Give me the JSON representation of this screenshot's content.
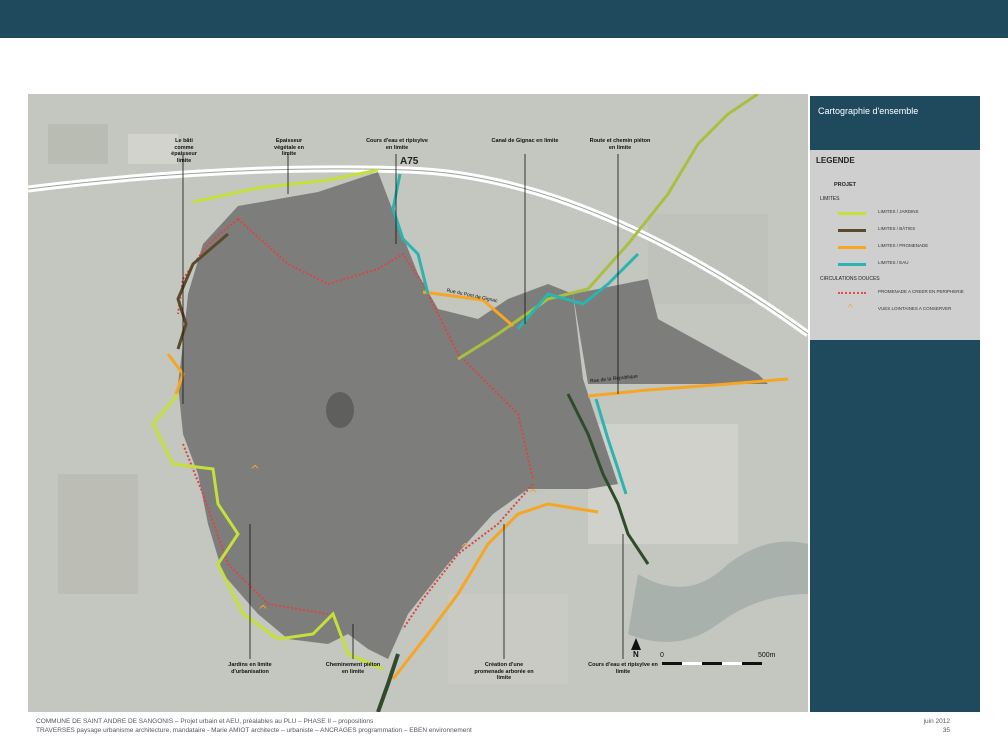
{
  "map": {
    "highway_label": "A75",
    "road_labels": {
      "pont_de_gignac": "Rue du Pont de Gignac",
      "republique": "Rue de la République"
    },
    "annotations_top": [
      {
        "id": "bati",
        "text": "Le bâti comme épaisseur limite"
      },
      {
        "id": "vegetale",
        "text": "Epaisseur végétale en limite"
      },
      {
        "id": "cours_eau",
        "text": "Cours d'eau et ripisylve en limite"
      },
      {
        "id": "canal",
        "text": "Canal de Gignac en limite"
      },
      {
        "id": "route",
        "text": "Route et chemin piéton en limite"
      }
    ],
    "annotations_bottom": [
      {
        "id": "jardins",
        "text": "Jardins en limite d'urbanisation"
      },
      {
        "id": "cheminement",
        "text": "Cheminement piéton en limite"
      },
      {
        "id": "promenade",
        "text": "Création d'une promenade arborée en limite"
      },
      {
        "id": "cours_eau_bas",
        "text": "Cours d'eau et ripisylve en limite"
      }
    ],
    "north_label": "N",
    "scale": {
      "start": "0",
      "end": "500m"
    }
  },
  "panel": {
    "title": "Cartographie d'ensemble",
    "legend_title": "LEGENDE",
    "projet": "PROJET",
    "limites": "LIMITES",
    "items": [
      {
        "label": "LIMITES / JARDINS",
        "color": "#c6e03a"
      },
      {
        "label": "LIMITES / BÂTIES",
        "color": "#5a4a2a"
      },
      {
        "label": "LIMITES / PROMENADE",
        "color": "#f5a623"
      },
      {
        "label": "LIMITES / EAU",
        "color": "#2ab5b0"
      }
    ],
    "circulations": "CIRCULATIONS DOUCES",
    "circ_items": [
      {
        "label": "PROMENADE A CREER EN PERIPHERIE",
        "color": "#e05050"
      },
      {
        "label": "VUES LOINTAINES A CONSERVER",
        "color": "#f5a623"
      }
    ]
  },
  "footer": {
    "line1": "COMMUNE DE SAINT ANDRE DE SANGONIS – Projet urbain et AEU, préalables au PLU – PHASE II – propositions",
    "line2": "TRAVERSES paysage urbanisme architecture, mandataire - Marie AMIOT architecte – urbaniste – ANCRAGES programmation – EBEN environnement",
    "date": "juin  2012",
    "page": "35"
  }
}
